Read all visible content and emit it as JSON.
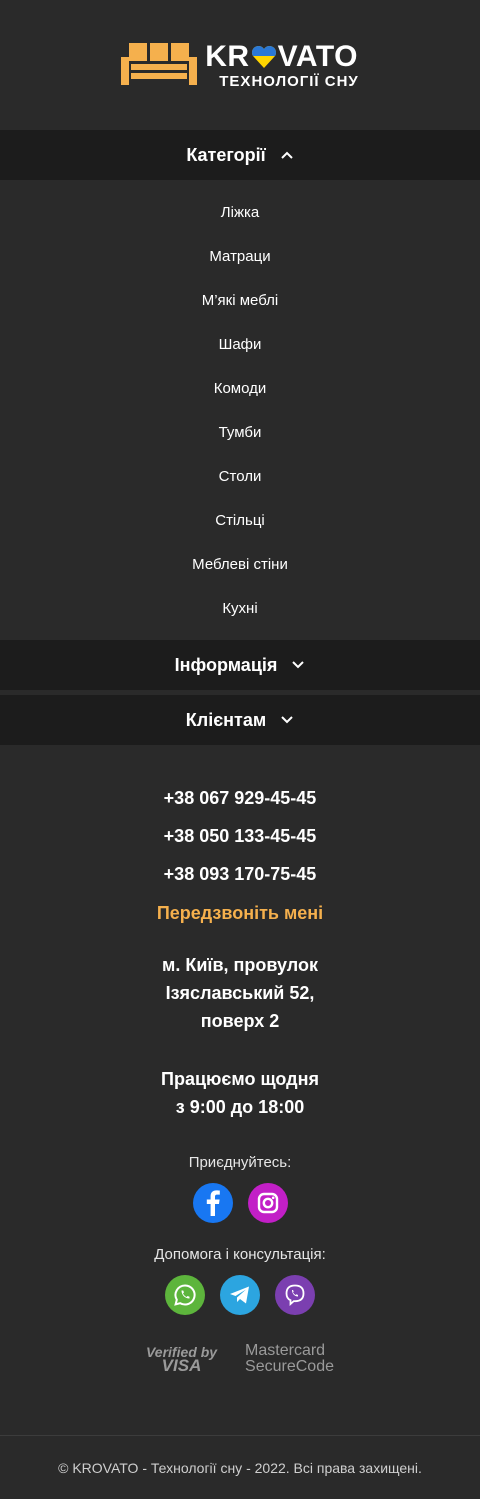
{
  "logo": {
    "brand_left": "KR",
    "brand_right": "VATO",
    "tagline": "ТЕХНОЛОГІЇ СНУ"
  },
  "categories": {
    "title": "Категорії",
    "items": [
      "Ліжка",
      "Матраци",
      "М’які меблі",
      "Шафи",
      "Комоди",
      "Тумби",
      "Столи",
      "Стільці",
      "Меблеві стіни",
      "Кухні"
    ]
  },
  "info": {
    "title": "Інформація"
  },
  "clients": {
    "title": "Клієнтам"
  },
  "contacts": {
    "phones": [
      "+38 067 929-45-45",
      "+38 050 133-45-45",
      "+38 093 170-75-45"
    ],
    "callback": "Передзвоніть мені",
    "address": [
      "м. Київ, провулок",
      "Ізяславський 52,",
      "поверх 2"
    ],
    "hours": [
      "Працюємо щодня",
      "з 9:00 до 18:00"
    ],
    "join_label": "Приєднуйтесь:",
    "help_label": "Допомога і консультація:"
  },
  "payments": {
    "visa_top": "Verified by",
    "visa_bottom": "VISA",
    "mc_top": "Mastercard",
    "mc_bottom": "SecureCode"
  },
  "footer": {
    "copyright": "© KROVATO - Технології сну - 2022. Всі права захищені."
  },
  "colors": {
    "accent": "#f5b04d",
    "facebook": "#1877f2",
    "instagram": "#c21fc7",
    "whatsapp": "#5db53c",
    "telegram": "#2ca5e0",
    "viber": "#7b3fb0"
  },
  "icons": [
    "sofa-logo-icon",
    "heart-icon",
    "chevron-up-icon",
    "chevron-down-icon",
    "facebook-icon",
    "instagram-icon",
    "whatsapp-icon",
    "telegram-icon",
    "viber-icon"
  ]
}
